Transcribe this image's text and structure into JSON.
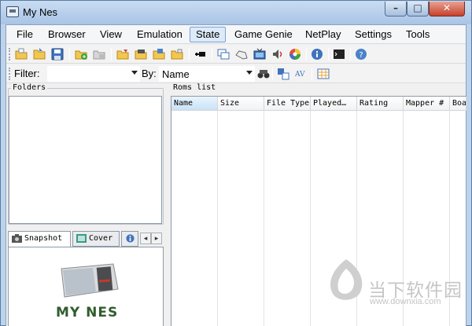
{
  "window": {
    "title": "My Nes",
    "controls": {
      "minimize": "–",
      "maximize": "□",
      "close": "✕"
    }
  },
  "menu": {
    "items": [
      "File",
      "Browser",
      "View",
      "Emulation",
      "State",
      "Game Genie",
      "NetPlay",
      "Settings",
      "Tools"
    ],
    "active": "State"
  },
  "filterbar": {
    "filter_label": "Filter:",
    "filter_value": "",
    "by_label": "By:",
    "by_value": "Name"
  },
  "folders": {
    "title": "Folders"
  },
  "tabs": [
    {
      "label": "Snapshot",
      "icon": "camera-icon",
      "active": true
    },
    {
      "label": "Cover",
      "icon": "cover-icon",
      "active": false
    }
  ],
  "tab_info_icon": "info-icon",
  "tab_scroll": {
    "left": "◂",
    "right": "▸"
  },
  "roms": {
    "title": "Roms list",
    "columns": [
      "Name",
      "Size",
      "File Type",
      "Played…",
      "Rating",
      "Mapper #",
      "Boa"
    ],
    "sorted_column": "Name",
    "rows": []
  },
  "snapshot": {
    "text": "MY NES"
  },
  "watermark": {
    "chinese": "当下软件园",
    "url": "www.downxia.com"
  },
  "toolbar_icons": [
    "open-icon",
    "open-folder-icon",
    "save-icon",
    "add-folder-icon",
    "remove-icon",
    "folder-edit-icon",
    "folder-open-icon",
    "folder-play-icon",
    "folder-sync-icon",
    "plug-icon",
    "window-icon",
    "gamepad-icon",
    "tv-icon",
    "speaker-icon",
    "palette-icon",
    "info-icon",
    "console-icon",
    "help-icon"
  ]
}
